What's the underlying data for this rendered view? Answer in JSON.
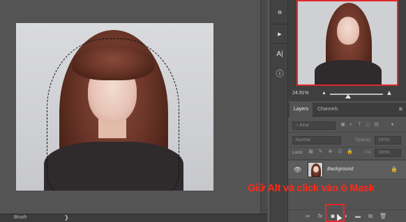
{
  "status_bar": {
    "tool_label": "Brush",
    "arrow": "❯"
  },
  "tools": [
    {
      "icon": "object-icon",
      "glyph": "⧉"
    },
    {
      "icon": "play-icon",
      "glyph": "▶"
    },
    {
      "icon": "character-icon",
      "glyph": "A|"
    },
    {
      "icon": "info-icon",
      "glyph": "ⓘ"
    }
  ],
  "navigator": {
    "zoom": "24.91%"
  },
  "layers_panel": {
    "tabs": [
      "Layers",
      "Channels"
    ],
    "filter_label": "Kind",
    "blend_mode": "Normal",
    "opacity_label": "Opacity:",
    "opacity_value": "100%",
    "lock_label": "Lock:",
    "fill_label": "Fill:",
    "fill_value": "100%",
    "layer_name": "Background"
  },
  "annotation": {
    "text": "Giữ Alt và click vào ô Mask",
    "color": "#ff2a1a"
  },
  "accent_colors": {
    "highlight": "#e8282a",
    "proxy_frame": "#e0282a"
  }
}
